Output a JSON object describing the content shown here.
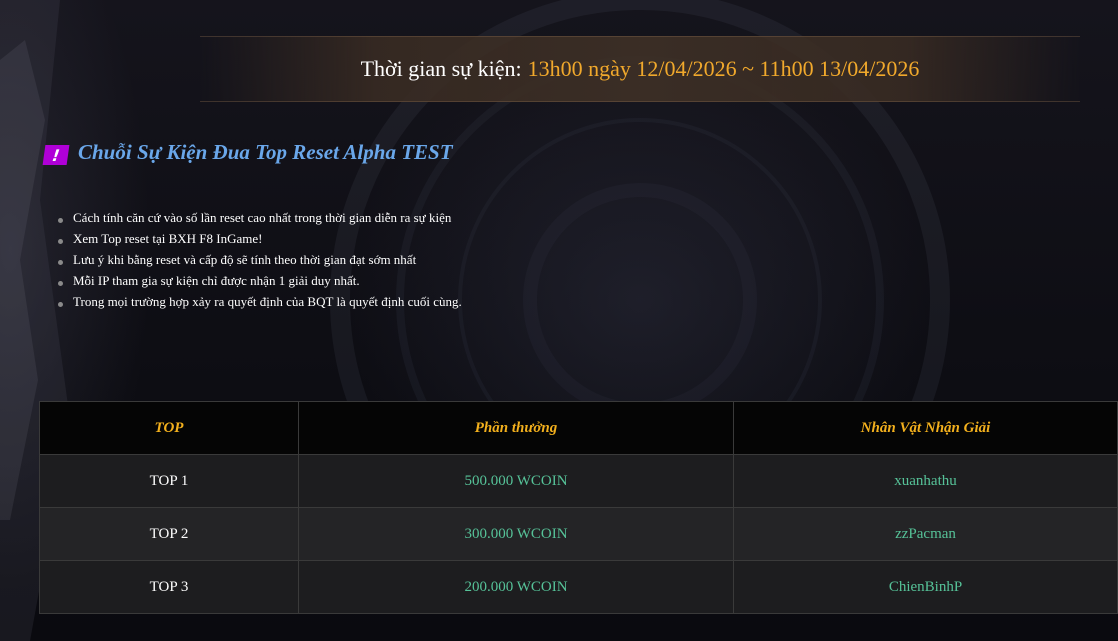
{
  "event": {
    "label": "Thời gian sự kiện:",
    "time": "13h00 ngày 12/04/2026 ~ 11h00 13/04/2026"
  },
  "section": {
    "icon": "!",
    "title": "Chuỗi Sự Kiện Đua Top Reset Alpha TEST"
  },
  "rules": [
    "Cách tính căn cứ vào số lần reset cao nhất trong thời gian diễn ra sự kiện",
    "Xem Top reset tại BXH F8 InGame!",
    "Lưu ý khi bằng reset và cấp độ sẽ tính theo thời gian đạt sớm nhất",
    "Mỗi IP tham gia sự kiện chỉ được nhận 1 giải duy nhất.",
    "Trong mọi trường hợp xảy ra quyết định của BQT là quyết định cuối cùng."
  ],
  "table": {
    "headers": [
      "TOP",
      "Phần thưởng",
      "Nhân Vật Nhận Giải"
    ],
    "rows": [
      {
        "top": "TOP 1",
        "reward": "500.000 WCOIN",
        "winner": "xuanhathu"
      },
      {
        "top": "TOP 2",
        "reward": "300.000 WCOIN",
        "winner": "zzPacman"
      },
      {
        "top": "TOP 3",
        "reward": "200.000 WCOIN",
        "winner": "ChienBinhP"
      }
    ]
  },
  "colors": {
    "accent_gold": "#f1a92c",
    "title_blue": "#6aa7ea",
    "icon_magenta": "#b000d8",
    "value_green": "#56c298"
  }
}
